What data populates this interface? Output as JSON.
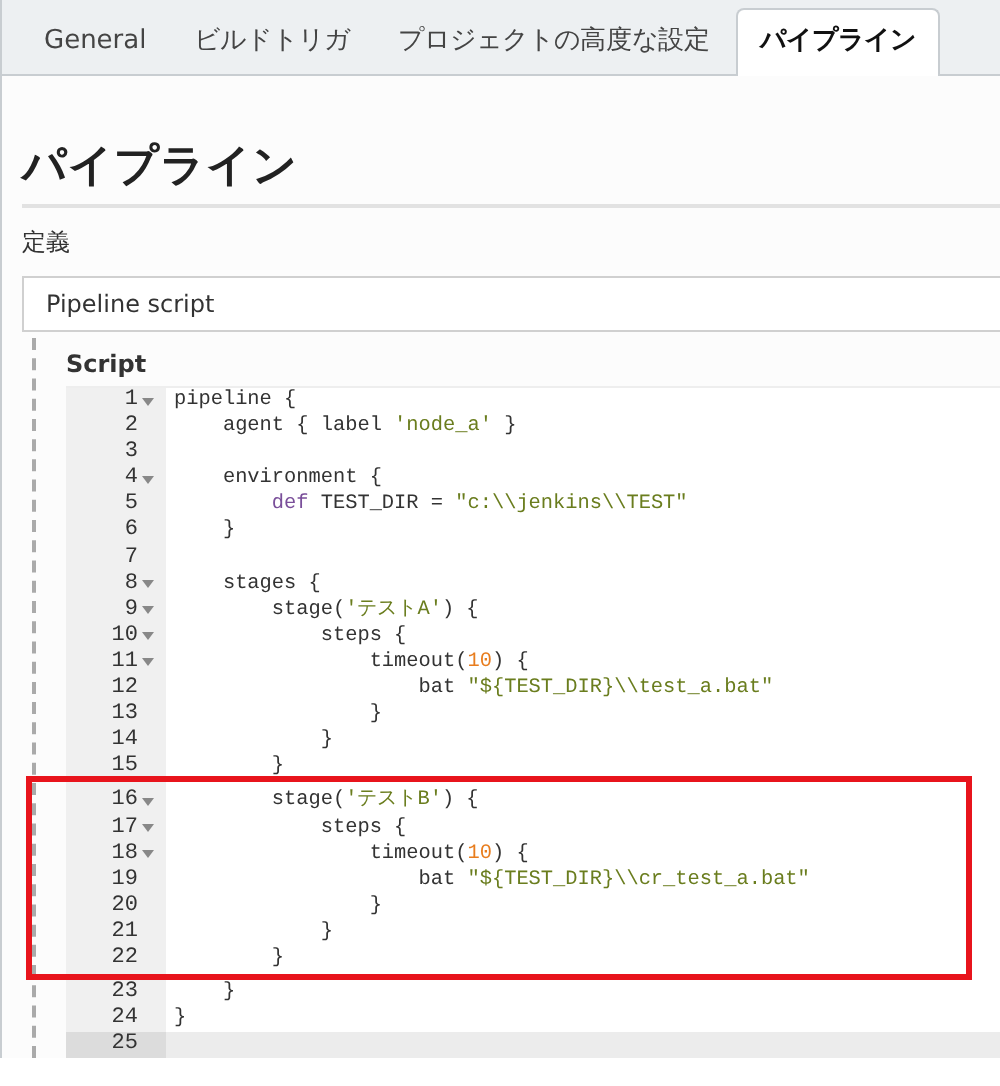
{
  "tabs": [
    {
      "label": "General",
      "selected": false
    },
    {
      "label": "ビルドトリガ",
      "selected": false
    },
    {
      "label": "プロジェクトの高度な設定",
      "selected": false
    },
    {
      "label": "パイプライン",
      "selected": true
    }
  ],
  "section_title": "パイプライン",
  "definition": {
    "label": "定義",
    "value": "Pipeline script"
  },
  "script": {
    "label": "Script",
    "lines": [
      {
        "number": "1",
        "foldable": true,
        "active": false,
        "tokens": [
          {
            "kind": "plain",
            "text": "pipeline {"
          }
        ]
      },
      {
        "number": "2",
        "foldable": false,
        "active": false,
        "tokens": [
          {
            "kind": "plain",
            "text": "    agent { label "
          },
          {
            "kind": "string",
            "text": "'node_a'"
          },
          {
            "kind": "plain",
            "text": " }"
          }
        ]
      },
      {
        "number": "3",
        "foldable": false,
        "active": false
      },
      {
        "number": "4",
        "foldable": true,
        "active": false,
        "tokens": [
          {
            "kind": "plain",
            "text": "    environment {"
          }
        ]
      },
      {
        "number": "5",
        "foldable": false,
        "active": false,
        "tokens": [
          {
            "kind": "keyword",
            "text": "        def"
          },
          {
            "kind": "plain",
            "text": " TEST_DIR = "
          },
          {
            "kind": "string",
            "text": "\"c:\\\\jenkins\\\\TEST\""
          }
        ]
      },
      {
        "number": "6",
        "foldable": false,
        "active": false,
        "tokens": [
          {
            "kind": "plain",
            "text": "    }"
          }
        ]
      },
      {
        "number": "7",
        "foldable": false,
        "active": false
      },
      {
        "number": "8",
        "foldable": true,
        "active": false,
        "tokens": [
          {
            "kind": "plain",
            "text": "    stages {"
          }
        ]
      },
      {
        "number": "9",
        "foldable": true,
        "active": false,
        "tokens": [
          {
            "kind": "plain",
            "text": "        stage("
          },
          {
            "kind": "string",
            "text": "'テストA'"
          },
          {
            "kind": "plain",
            "text": ") {"
          }
        ]
      },
      {
        "number": "10",
        "foldable": true,
        "active": false,
        "tokens": [
          {
            "kind": "plain",
            "text": "            steps {"
          }
        ]
      },
      {
        "number": "11",
        "foldable": true,
        "active": false,
        "tokens": [
          {
            "kind": "plain",
            "text": "                timeout("
          },
          {
            "kind": "number",
            "text": "10"
          },
          {
            "kind": "plain",
            "text": ") {"
          }
        ]
      },
      {
        "number": "12",
        "foldable": false,
        "active": false,
        "tokens": [
          {
            "kind": "plain",
            "text": "                    bat "
          },
          {
            "kind": "string",
            "text": "\"${TEST_DIR}\\\\test_a.bat\""
          }
        ]
      },
      {
        "number": "13",
        "foldable": false,
        "active": false,
        "tokens": [
          {
            "kind": "plain",
            "text": "                }"
          }
        ]
      },
      {
        "number": "14",
        "foldable": false,
        "active": false,
        "tokens": [
          {
            "kind": "plain",
            "text": "            }"
          }
        ]
      },
      {
        "number": "15",
        "foldable": false,
        "active": false,
        "tokens": [
          {
            "kind": "plain",
            "text": "        }"
          }
        ]
      },
      {
        "number": "16",
        "foldable": true,
        "active": false,
        "tokens": [
          {
            "kind": "plain",
            "text": "        stage("
          },
          {
            "kind": "string",
            "text": "'テストB'"
          },
          {
            "kind": "plain",
            "text": ") {"
          }
        ]
      },
      {
        "number": "17",
        "foldable": true,
        "active": false,
        "tokens": [
          {
            "kind": "plain",
            "text": "            steps {"
          }
        ]
      },
      {
        "number": "18",
        "foldable": true,
        "active": false,
        "tokens": [
          {
            "kind": "plain",
            "text": "                timeout("
          },
          {
            "kind": "number",
            "text": "10"
          },
          {
            "kind": "plain",
            "text": ") {"
          }
        ]
      },
      {
        "number": "19",
        "foldable": false,
        "active": false,
        "tokens": [
          {
            "kind": "plain",
            "text": "                    bat "
          },
          {
            "kind": "string",
            "text": "\"${TEST_DIR}\\\\cr_test_a.bat\""
          }
        ]
      },
      {
        "number": "20",
        "foldable": false,
        "active": false,
        "tokens": [
          {
            "kind": "plain",
            "text": "                }"
          }
        ]
      },
      {
        "number": "21",
        "foldable": false,
        "active": false,
        "tokens": [
          {
            "kind": "plain",
            "text": "            }"
          }
        ]
      },
      {
        "number": "22",
        "foldable": false,
        "active": false,
        "tokens": [
          {
            "kind": "plain",
            "text": "        }"
          }
        ]
      },
      {
        "number": "23",
        "foldable": false,
        "active": false,
        "tokens": [
          {
            "kind": "plain",
            "text": "    }"
          }
        ]
      },
      {
        "number": "24",
        "foldable": false,
        "active": false,
        "tokens": [
          {
            "kind": "plain",
            "text": "}"
          }
        ]
      },
      {
        "number": "25",
        "foldable": false,
        "active": true
      }
    ]
  }
}
